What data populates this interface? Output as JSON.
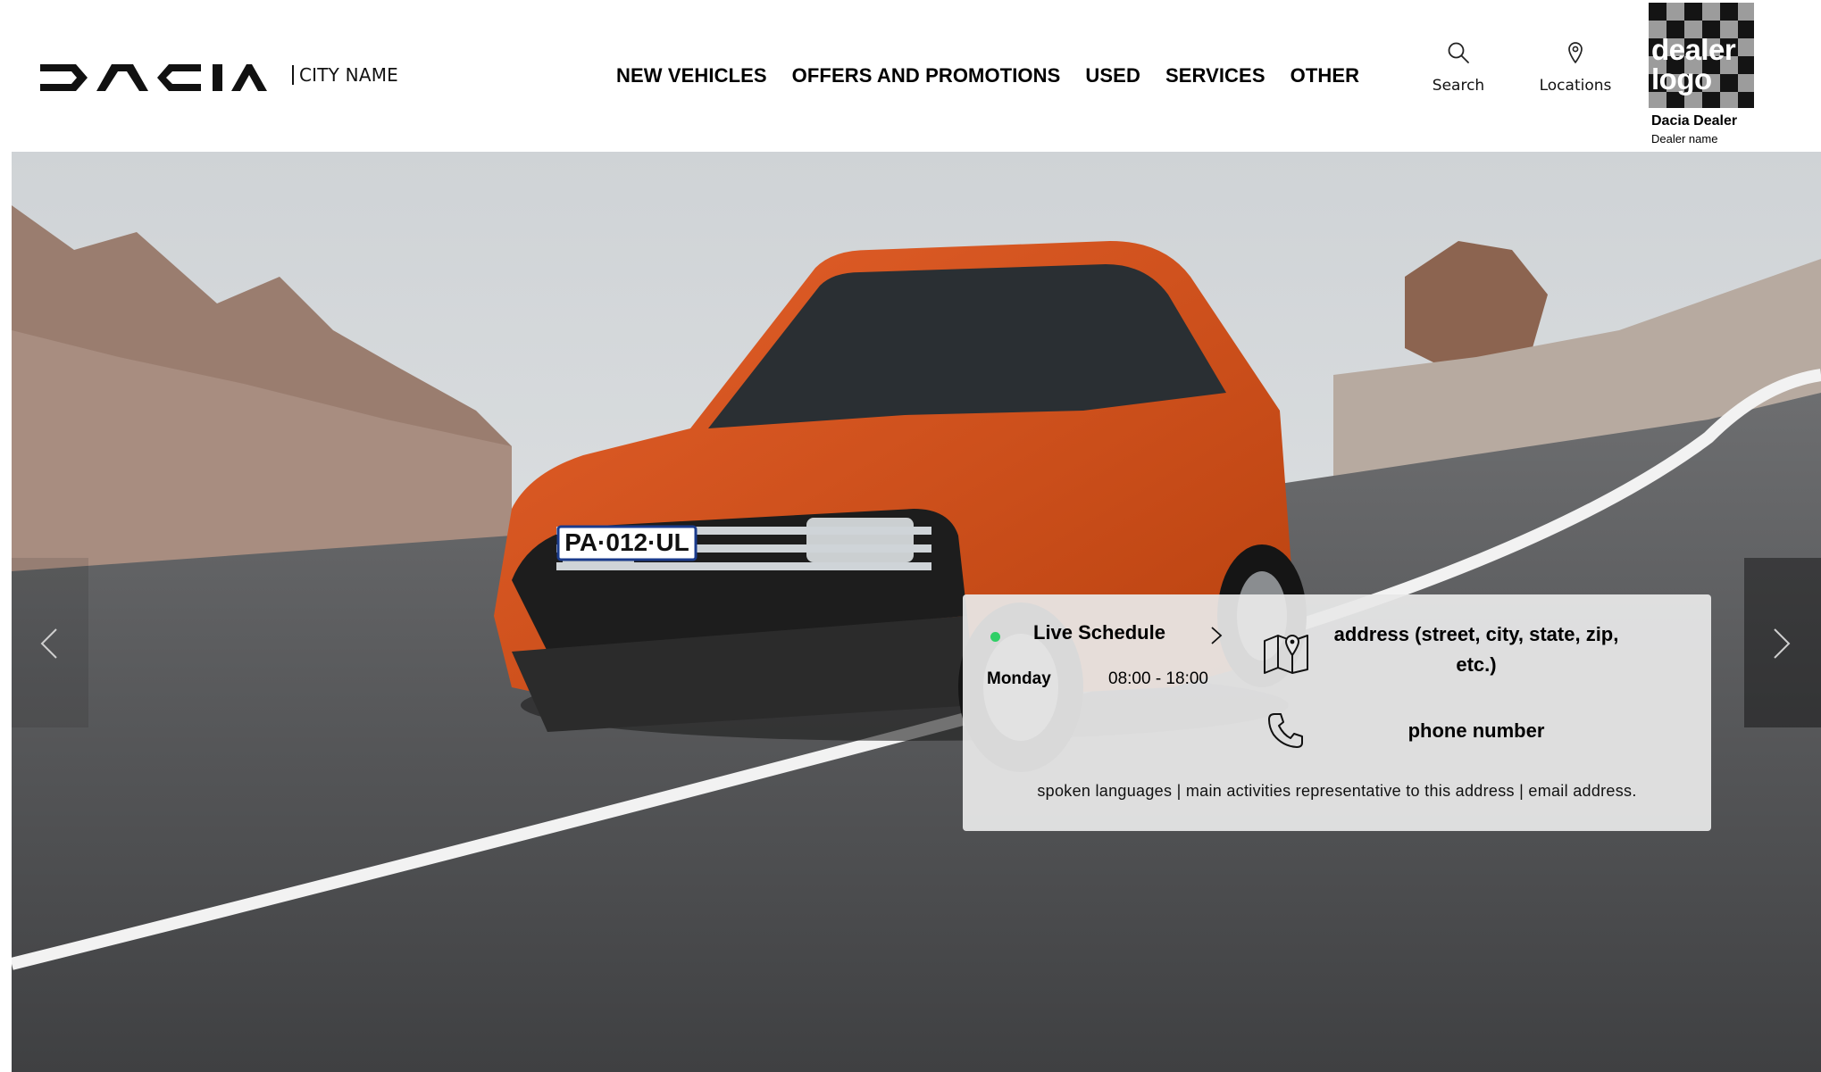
{
  "header": {
    "brand": "DACIA",
    "city": "CITY NAME",
    "nav": [
      "NEW VEHICLES",
      "OFFERS AND PROMOTIONS",
      "USED",
      "SERVICES",
      "OTHER"
    ],
    "search_label": "Search",
    "locations_label": "Locations",
    "dealer_logo_text": "dealer logo",
    "dealer_title": "Dacia Dealer",
    "dealer_subtitle": "Dealer name"
  },
  "hero": {
    "plate": "PA·012·UL",
    "carousel": {
      "prev_icon": "chevron-left-icon",
      "next_icon": "chevron-right-icon"
    }
  },
  "info": {
    "status_color": "#2fcf66",
    "schedule_title": "Live Schedule",
    "day": "Monday",
    "hours": "08:00 - 18:00",
    "address": "address (street, city, state, zip, etc.)",
    "phone": "phone number",
    "footnote": "spoken languages | main activities representative to this address | email address."
  }
}
